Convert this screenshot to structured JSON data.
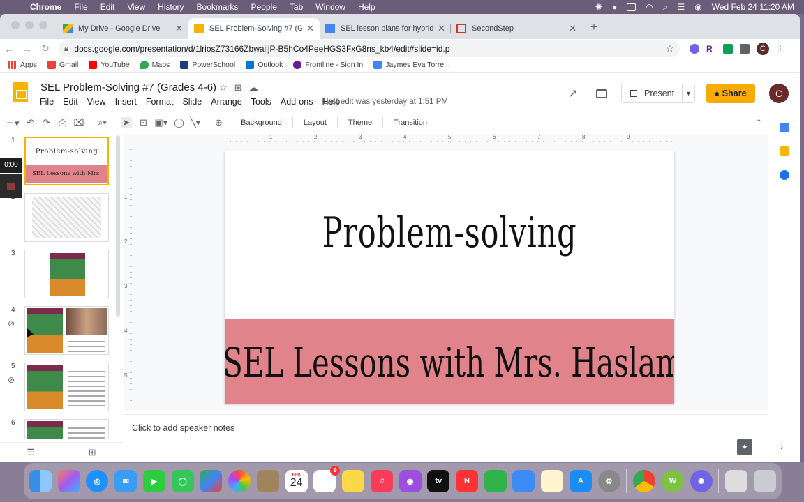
{
  "menubar": {
    "app": "Chrome",
    "items": [
      "File",
      "Edit",
      "View",
      "History",
      "Bookmarks",
      "People",
      "Tab",
      "Window",
      "Help"
    ],
    "clock": "Wed Feb 24  11:20 AM"
  },
  "tabs": [
    {
      "title": "My Drive - Google Drive",
      "color": "#fbbc04"
    },
    {
      "title": "SEL Problem-Solving #7 (Grad",
      "color": "#f4b400"
    },
    {
      "title": "SEL lesson plans for hybrid lea",
      "color": "#4285f4"
    },
    {
      "title": "SecondStep",
      "color": "#d93025"
    }
  ],
  "url": "docs.google.com/presentation/d/1lriosZ73166ZbwailjP-B5hCo4PeeHGS3FxG8ns_kb4/edit#slide=id.p",
  "bookmarks": [
    {
      "label": "Apps",
      "color": "#ea4335"
    },
    {
      "label": "Gmail",
      "color": "#ea4335"
    },
    {
      "label": "YouTube",
      "color": "#ff0000"
    },
    {
      "label": "Maps",
      "color": "#34a853"
    },
    {
      "label": "PowerSchool",
      "color": "#1a3d7c"
    },
    {
      "label": "Outlook",
      "color": "#0078d4"
    },
    {
      "label": "Frontline - Sign In",
      "color": "#6a1b9a"
    },
    {
      "label": "Jaymes Eva Torre...",
      "color": "#4285f4"
    }
  ],
  "doc": {
    "title": "SEL Problem-Solving #7 (Grades 4-6)",
    "menu": [
      "File",
      "Edit",
      "View",
      "Insert",
      "Format",
      "Slide",
      "Arrange",
      "Tools",
      "Add-ons",
      "Help"
    ],
    "last_edit": "Last edit was yesterday at 1:51 PM",
    "present_label": "Present",
    "share_label": "Share",
    "avatar_letter": "C"
  },
  "toolbar": {
    "background": "Background",
    "layout": "Layout",
    "theme": "Theme",
    "transition": "Transition"
  },
  "recording": {
    "time": "0:00"
  },
  "slides": [
    {
      "num": "1",
      "top": "Problem-solving",
      "bottom": "SEL Lessons with Mrs. Haslam"
    },
    {
      "num": "2"
    },
    {
      "num": "3",
      "label": "Problem-Solving Steps"
    },
    {
      "num": "4",
      "label": "Problem-Solving Steps",
      "text": "What is the problem?"
    },
    {
      "num": "5",
      "label": "Problem-Solving Steps",
      "text": "Possible Solutions:"
    },
    {
      "num": "6",
      "label": "Problem-Solving Steps"
    }
  ],
  "ruler": {
    "h": [
      "1",
      "2",
      "3",
      "4",
      "5",
      "6",
      "7",
      "8",
      "9"
    ],
    "v": [
      "1",
      "2",
      "3",
      "4",
      "5"
    ]
  },
  "slide": {
    "title": "Problem-solving",
    "subtitle": "SEL Lessons with Mrs. Haslam",
    "band_color": "#e0838b"
  },
  "notes_placeholder": "Click to add speaker notes",
  "dock": {
    "calendar_month": "FEB",
    "calendar_day": "24",
    "reminders_badge": "9",
    "tv": "tv"
  }
}
